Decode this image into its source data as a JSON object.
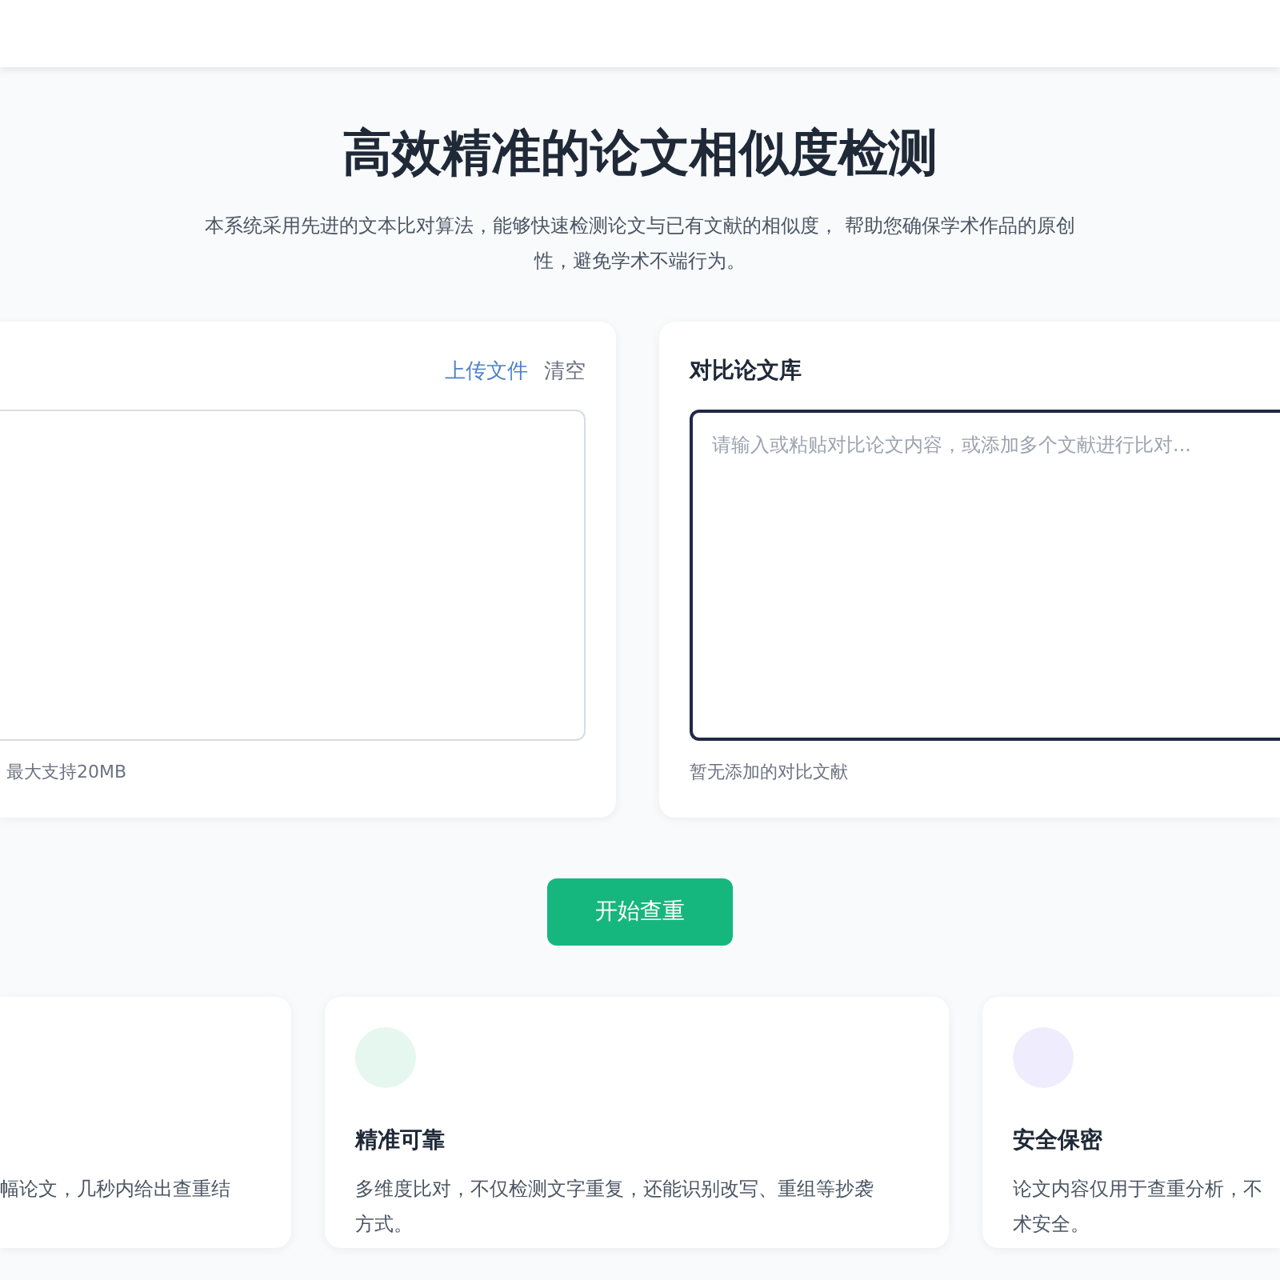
{
  "hero": {
    "title": "高效精准的论文相似度检测",
    "subtitle": "本系统采用先进的文本比对算法，能够快速检测论文与已有文献的相似度， 帮助您确保学术作品的原创性，避免学术不端行为。"
  },
  "source_panel": {
    "actions": [
      {
        "label": "上传文件",
        "kind": "link"
      },
      {
        "label": "清空",
        "kind": "plain"
      }
    ],
    "hint": "最大支持20MB"
  },
  "compare_panel": {
    "title": "对比论文库",
    "placeholder": "请输入或粘贴对比论文内容，或添加多个文献进行比对...",
    "focused": true,
    "hint": "暂无添加的对比文献"
  },
  "start_button": "开始查重",
  "features": [
    {
      "lines": [
        "幅论文，几秒内给出查重结"
      ]
    },
    {
      "title": "精准可靠",
      "color": "#e6f7ef",
      "lines": [
        "多维度比对，不仅检测文字重复，还能识别改写、重组等抄袭",
        "方式。"
      ]
    },
    {
      "title": "安全保密",
      "color": "#efedfd",
      "lines": [
        "论文内容仅用于查重分析，不",
        "术安全。"
      ]
    }
  ]
}
